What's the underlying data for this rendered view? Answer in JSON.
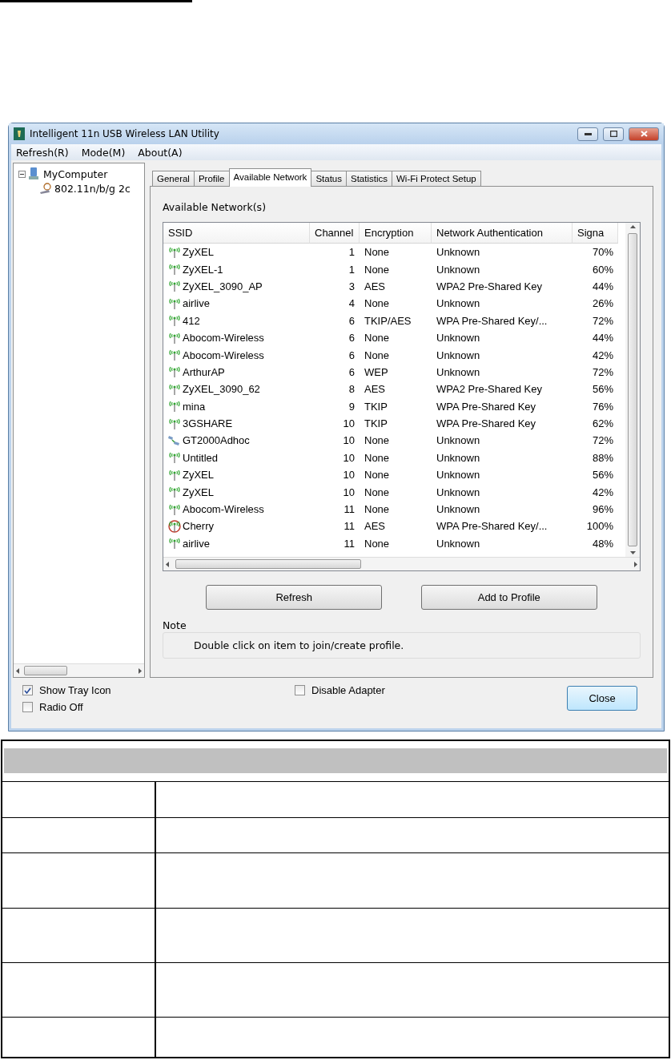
{
  "window": {
    "title": "Intelligent 11n USB Wireless LAN Utility"
  },
  "menu": [
    "Refresh(R)",
    "Mode(M)",
    "About(A)"
  ],
  "tree": {
    "label": "MyComputer",
    "expanded": true,
    "children": [
      {
        "label": "802.11n/b/g 2c"
      }
    ]
  },
  "tabs": [
    {
      "label": "General",
      "selected": false
    },
    {
      "label": "Profile",
      "selected": false
    },
    {
      "label": "Available Network",
      "selected": true
    },
    {
      "label": "Status",
      "selected": false
    },
    {
      "label": "Statistics",
      "selected": false
    },
    {
      "label": "Wi-Fi Protect Setup",
      "selected": false
    }
  ],
  "network_list": {
    "title": "Available Network(s)",
    "columns": [
      "SSID",
      "Channel",
      "Encryption",
      "Network Authentication",
      "Signa"
    ],
    "rows": [
      {
        "kind": "ap",
        "ssid": "ZyXEL",
        "channel": "1",
        "encryption": "None",
        "authentication": "Unknown",
        "signal": "70%"
      },
      {
        "kind": "ap",
        "ssid": "ZyXEL-1",
        "channel": "1",
        "encryption": "None",
        "authentication": "Unknown",
        "signal": "60%"
      },
      {
        "kind": "ap",
        "ssid": "ZyXEL_3090_AP",
        "channel": "3",
        "encryption": "AES",
        "authentication": "WPA2 Pre-Shared Key",
        "signal": "44%"
      },
      {
        "kind": "ap",
        "ssid": "airlive",
        "channel": "4",
        "encryption": "None",
        "authentication": "Unknown",
        "signal": "26%"
      },
      {
        "kind": "ap",
        "ssid": "412",
        "channel": "6",
        "encryption": "TKIP/AES",
        "authentication": "WPA Pre-Shared Key/...",
        "signal": "72%"
      },
      {
        "kind": "ap",
        "ssid": "Abocom-Wireless",
        "channel": "6",
        "encryption": "None",
        "authentication": "Unknown",
        "signal": "44%"
      },
      {
        "kind": "ap",
        "ssid": "Abocom-Wireless",
        "channel": "6",
        "encryption": "None",
        "authentication": "Unknown",
        "signal": "42%"
      },
      {
        "kind": "ap",
        "ssid": "ArthurAP",
        "channel": "6",
        "encryption": "WEP",
        "authentication": "Unknown",
        "signal": "72%"
      },
      {
        "kind": "ap",
        "ssid": "ZyXEL_3090_62",
        "channel": "8",
        "encryption": "AES",
        "authentication": "WPA2 Pre-Shared Key",
        "signal": "56%"
      },
      {
        "kind": "ap",
        "ssid": "mina",
        "channel": "9",
        "encryption": "TKIP",
        "authentication": "WPA Pre-Shared Key",
        "signal": "76%"
      },
      {
        "kind": "ap",
        "ssid": "3GSHARE",
        "channel": "10",
        "encryption": "TKIP",
        "authentication": "WPA Pre-Shared Key",
        "signal": "62%"
      },
      {
        "kind": "adhoc",
        "ssid": "GT2000Adhoc",
        "channel": "10",
        "encryption": "None",
        "authentication": "Unknown",
        "signal": "72%"
      },
      {
        "kind": "ap",
        "ssid": "Untitled",
        "channel": "10",
        "encryption": "None",
        "authentication": "Unknown",
        "signal": "88%"
      },
      {
        "kind": "ap",
        "ssid": "ZyXEL",
        "channel": "10",
        "encryption": "None",
        "authentication": "Unknown",
        "signal": "56%"
      },
      {
        "kind": "ap",
        "ssid": "ZyXEL",
        "channel": "10",
        "encryption": "None",
        "authentication": "Unknown",
        "signal": "42%"
      },
      {
        "kind": "ap",
        "ssid": "Abocom-Wireless",
        "channel": "11",
        "encryption": "None",
        "authentication": "Unknown",
        "signal": "96%"
      },
      {
        "kind": "ringed",
        "ssid": "Cherry",
        "channel": "11",
        "encryption": "AES",
        "authentication": "WPA Pre-Shared Key/...",
        "signal": "100%"
      },
      {
        "kind": "ap",
        "ssid": "airlive",
        "channel": "11",
        "encryption": "None",
        "authentication": "Unknown",
        "signal": "48%"
      }
    ]
  },
  "buttons": [
    "Refresh",
    "Add to Profile"
  ],
  "note": {
    "title": "Note",
    "text": "Double click on item to join/create profile."
  },
  "options": [
    {
      "label": "Show Tray Icon",
      "checked": true
    },
    {
      "label": "Radio Off",
      "checked": false
    },
    {
      "label": "Disable Adapter",
      "checked": false
    }
  ],
  "close_button": "Close"
}
